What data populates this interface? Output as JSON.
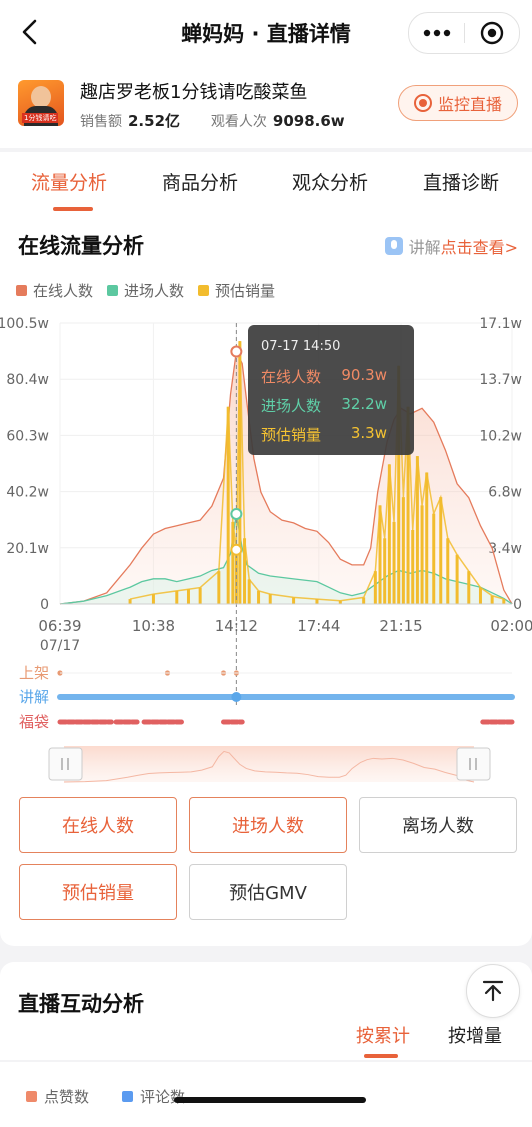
{
  "header": {
    "title": "蝉妈妈 · 直播详情"
  },
  "live": {
    "title": "趣店罗老板1分钱请吃酸菜鱼",
    "sales_label": "销售额",
    "sales_value": "2.52亿",
    "viewers_label": "观看人次",
    "viewers_value": "9098.6w",
    "monitor_label": "监控直播",
    "thumb_tag": "1分钱请吃"
  },
  "tabs": [
    {
      "label": "流量分析",
      "active": true
    },
    {
      "label": "商品分析",
      "active": false
    },
    {
      "label": "观众分析",
      "active": false
    },
    {
      "label": "直播诊断",
      "active": false
    }
  ],
  "traffic": {
    "title": "在线流量分析",
    "explain_prefix": "讲解",
    "explain_link": "点击查看>"
  },
  "chart_data": {
    "type": "line",
    "legend": [
      {
        "name": "在线人数",
        "color": "#e57b5c"
      },
      {
        "name": "进场人数",
        "color": "#5cc8a0"
      },
      {
        "name": "预估销量",
        "color": "#f2bc2e"
      }
    ],
    "left_axis_ticks": [
      "100.5w",
      "80.4w",
      "60.3w",
      "40.2w",
      "20.1w",
      "0"
    ],
    "right_axis_ticks": [
      "17.1w",
      "13.7w",
      "10.2w",
      "6.8w",
      "3.4w",
      "0"
    ],
    "left_axis_range": [
      0,
      100.5
    ],
    "right_axis_range": [
      0,
      17.1
    ],
    "x_ticks": [
      "06:39",
      "10:38",
      "14:12",
      "17:44",
      "21:15",
      "02:00"
    ],
    "x_start_date": "07/17",
    "x_hours": [
      0,
      4,
      7.55,
      11.08,
      14.6,
      19.35
    ],
    "series": [
      {
        "name": "在线人数",
        "axis": "left",
        "points": [
          [
            0,
            0
          ],
          [
            1,
            1
          ],
          [
            2,
            4
          ],
          [
            3,
            14
          ],
          [
            3.5,
            20
          ],
          [
            4,
            25
          ],
          [
            4.5,
            27
          ],
          [
            5,
            28
          ],
          [
            5.5,
            29
          ],
          [
            6,
            30
          ],
          [
            6.5,
            35
          ],
          [
            7,
            45
          ],
          [
            7.3,
            75
          ],
          [
            7.55,
            90.3
          ],
          [
            7.8,
            86
          ],
          [
            8,
            72
          ],
          [
            8.3,
            52
          ],
          [
            8.6,
            40
          ],
          [
            9,
            33
          ],
          [
            9.5,
            30
          ],
          [
            10,
            29
          ],
          [
            10.5,
            27
          ],
          [
            11,
            26
          ],
          [
            11.5,
            22
          ],
          [
            12,
            16
          ],
          [
            12.5,
            14
          ],
          [
            13,
            14
          ],
          [
            13.3,
            20
          ],
          [
            13.6,
            40
          ],
          [
            14,
            58
          ],
          [
            14.3,
            66
          ],
          [
            14.6,
            70
          ],
          [
            15,
            68
          ],
          [
            15.5,
            70
          ],
          [
            16,
            65
          ],
          [
            16.5,
            55
          ],
          [
            17,
            43
          ],
          [
            17.5,
            38
          ],
          [
            18,
            28
          ],
          [
            18.5,
            20
          ],
          [
            19,
            5
          ],
          [
            19.35,
            0
          ]
        ]
      },
      {
        "name": "进场人数",
        "axis": "left",
        "points": [
          [
            0,
            0
          ],
          [
            1,
            1
          ],
          [
            2,
            3
          ],
          [
            3,
            6
          ],
          [
            3.5,
            8
          ],
          [
            4,
            9
          ],
          [
            4.5,
            9
          ],
          [
            5,
            8
          ],
          [
            5.5,
            9
          ],
          [
            6,
            10
          ],
          [
            6.5,
            12
          ],
          [
            7,
            13
          ],
          [
            7.3,
            18
          ],
          [
            7.55,
            32.2
          ],
          [
            7.8,
            20
          ],
          [
            8,
            14
          ],
          [
            8.5,
            11
          ],
          [
            9,
            10
          ],
          [
            10,
            9
          ],
          [
            11,
            8
          ],
          [
            11.5,
            6
          ],
          [
            12,
            4
          ],
          [
            12.5,
            3
          ],
          [
            13,
            4
          ],
          [
            13.5,
            7
          ],
          [
            14,
            10
          ],
          [
            14.5,
            12
          ],
          [
            15,
            11
          ],
          [
            15.5,
            12
          ],
          [
            16,
            11
          ],
          [
            16.5,
            9
          ],
          [
            17,
            8
          ],
          [
            17.5,
            7
          ],
          [
            18,
            6
          ],
          [
            18.5,
            4
          ],
          [
            19,
            2
          ],
          [
            19.35,
            0
          ]
        ]
      },
      {
        "name": "预估销量",
        "axis": "right",
        "style": "spikes",
        "points": [
          [
            3,
            0.3
          ],
          [
            4,
            0.6
          ],
          [
            5,
            0.8
          ],
          [
            5.5,
            0.9
          ],
          [
            6,
            1.0
          ],
          [
            6.8,
            2.0
          ],
          [
            7.2,
            12.0
          ],
          [
            7.4,
            5.0
          ],
          [
            7.55,
            3.3
          ],
          [
            7.7,
            16.0
          ],
          [
            7.9,
            4.0
          ],
          [
            8.1,
            1.5
          ],
          [
            8.5,
            0.8
          ],
          [
            9,
            0.6
          ],
          [
            10,
            0.4
          ],
          [
            11,
            0.3
          ],
          [
            12,
            0.2
          ],
          [
            13,
            0.4
          ],
          [
            13.5,
            2.0
          ],
          [
            13.7,
            6.0
          ],
          [
            13.9,
            4.0
          ],
          [
            14.1,
            8.5
          ],
          [
            14.3,
            5.0
          ],
          [
            14.5,
            14.5
          ],
          [
            14.7,
            6.5
          ],
          [
            14.9,
            12.0
          ],
          [
            15.1,
            4.5
          ],
          [
            15.3,
            9.0
          ],
          [
            15.5,
            6.0
          ],
          [
            15.7,
            8.0
          ],
          [
            16,
            5.5
          ],
          [
            16.3,
            6.5
          ],
          [
            16.6,
            4.0
          ],
          [
            17,
            3.0
          ],
          [
            17.5,
            2.0
          ],
          [
            18,
            1.0
          ],
          [
            18.5,
            0.5
          ],
          [
            19,
            0.3
          ]
        ]
      }
    ],
    "tooltip": {
      "time": "07-17 14:50",
      "rows": [
        {
          "name": "在线人数",
          "value": "90.3w",
          "color": "#f08a65"
        },
        {
          "name": "进场人数",
          "value": "32.2w",
          "color": "#5fd0a8"
        },
        {
          "name": "预估销量",
          "value": "3.3w",
          "color": "#f5c232"
        }
      ]
    },
    "event_rows": [
      {
        "label": "上架",
        "color": "#e89a73"
      },
      {
        "label": "讲解",
        "color": "#5aa7ea"
      },
      {
        "label": "福袋",
        "color": "#e06060"
      }
    ]
  },
  "metric_buttons": [
    {
      "label": "在线人数",
      "active": true
    },
    {
      "label": "进场人数",
      "active": true
    },
    {
      "label": "离场人数",
      "active": false
    },
    {
      "label": "预估销量",
      "active": true
    },
    {
      "label": "预估GMV",
      "active": false
    }
  ],
  "interaction": {
    "title": "直播互动分析",
    "mode_tabs": [
      {
        "label": "按累计",
        "active": true
      },
      {
        "label": "按增量",
        "active": false
      }
    ],
    "legend": [
      {
        "name": "点赞数",
        "color": "#ef8a6a"
      },
      {
        "name": "评论数",
        "color": "#5b9bf0"
      }
    ]
  }
}
